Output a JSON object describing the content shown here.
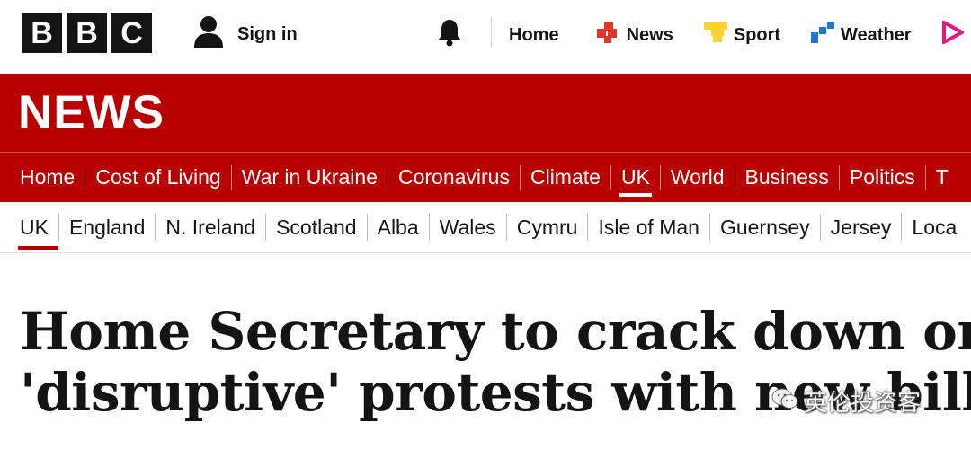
{
  "brand": {
    "letters": [
      "B",
      "B",
      "C"
    ]
  },
  "account": {
    "signin_label": "Sign in",
    "icon": "user-icon"
  },
  "notifications": {
    "icon": "bell-icon"
  },
  "top_nav": {
    "home": "Home",
    "news": "News",
    "sport": "Sport",
    "weather": "Weather"
  },
  "section": {
    "title": "NEWS"
  },
  "main_nav": {
    "items": [
      "Home",
      "Cost of Living",
      "War in Ukraine",
      "Coronavirus",
      "Climate",
      "UK",
      "World",
      "Business",
      "Politics",
      "T"
    ],
    "active": "UK"
  },
  "sub_nav": {
    "items": [
      "UK",
      "England",
      "N. Ireland",
      "Scotland",
      "Alba",
      "Wales",
      "Cymru",
      "Isle of Man",
      "Guernsey",
      "Jersey",
      "Loca"
    ],
    "active": "UK"
  },
  "article": {
    "headline_line1": "Home Secretary to crack down on",
    "headline_line2": "'disruptive' protests with new bill"
  },
  "watermark": {
    "text": "英伦投资客"
  },
  "colors": {
    "brand_red": "#b80000",
    "text": "#141414",
    "news_red": "#e13527",
    "sport_yellow": "#ffd230",
    "weather_blue": "#1e78d0"
  }
}
